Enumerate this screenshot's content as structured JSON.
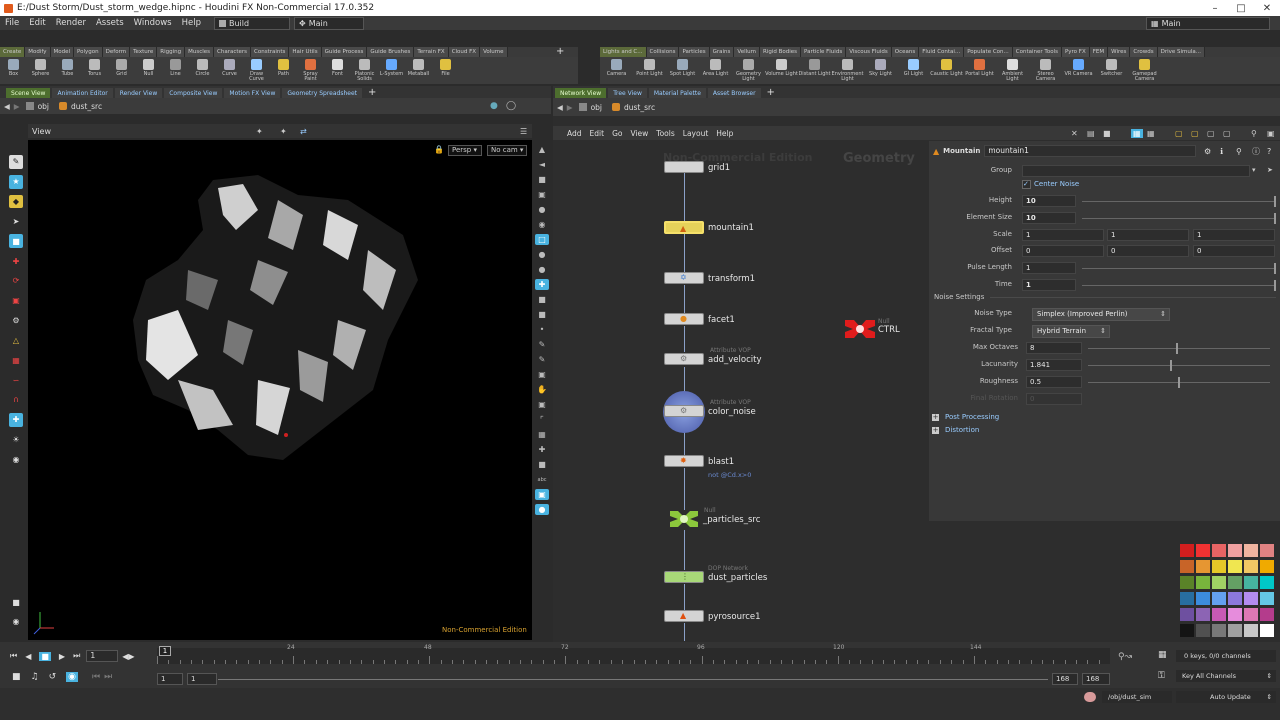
{
  "window": {
    "title": "E:/Dust Storm/Dust_storm_wedge.hipnc - Houdini FX Non-Commercial 17.0.352"
  },
  "menu": [
    "File",
    "Edit",
    "Render",
    "Assets",
    "Windows",
    "Help"
  ],
  "desktop": {
    "build": "Build",
    "main": "Main"
  },
  "shelf_left": {
    "tabs": [
      "Create",
      "Modify",
      "Model",
      "Polygon",
      "Deform",
      "Texture",
      "Rigging",
      "Muscles",
      "Characters",
      "Constraints",
      "Hair Utils",
      "Guide Process",
      "Guide Brushes",
      "Terrain FX",
      "Cloud FX",
      "Volume"
    ],
    "tools": [
      "Box",
      "Sphere",
      "Tube",
      "Torus",
      "Grid",
      "Null",
      "Line",
      "Circle",
      "Curve",
      "Draw Curve",
      "Path",
      "Spray Paint",
      "Font",
      "Platonic Solids",
      "L-System",
      "Metaball",
      "File"
    ]
  },
  "shelf_right": {
    "tabs": [
      "Lights and C...",
      "Collisions",
      "Particles",
      "Grains",
      "Vellum",
      "Rigid Bodies",
      "Particle Fluids",
      "Viscous Fluids",
      "Oceans",
      "Fluid Contai...",
      "Populate Con...",
      "Container Tools",
      "Pyro FX",
      "FEM",
      "Wires",
      "Crowds",
      "Drive Simula..."
    ],
    "tools": [
      "Camera",
      "Point Light",
      "Spot Light",
      "Area Light",
      "Geometry Light",
      "Volume Light",
      "Distant Light",
      "Environment Light",
      "Sky Light",
      "GI Light",
      "Caustic Light",
      "Portal Light",
      "Ambient Light",
      "Stereo Camera",
      "VR Camera",
      "Switcher",
      "Gamepad Camera"
    ]
  },
  "left_pane": {
    "tabs": [
      "Scene View",
      "Animation Editor",
      "Render View",
      "Composite View",
      "Motion FX View",
      "Geometry Spreadsheet"
    ],
    "path": [
      "obj",
      "dust_src"
    ],
    "view_label": "View",
    "persp": "Persp",
    "cam": "No cam",
    "watermark": "Non-Commercial Edition"
  },
  "right_pane": {
    "tabs": [
      "Network View",
      "Tree View",
      "Material Palette",
      "Asset Browser"
    ],
    "path": [
      "obj",
      "dust_src"
    ],
    "menu": [
      "Add",
      "Edit",
      "Go",
      "View",
      "Tools",
      "Layout",
      "Help"
    ],
    "nc_watermark": "Non-Commercial Edition",
    "context_label": "Geometry"
  },
  "nodes": [
    {
      "name": "grid1",
      "type": ""
    },
    {
      "name": "mountain1",
      "type": ""
    },
    {
      "name": "transform1",
      "type": ""
    },
    {
      "name": "facet1",
      "type": ""
    },
    {
      "name": "add_velocity",
      "type": "Attribute VOP"
    },
    {
      "name": "color_noise",
      "type": "Attribute VOP"
    },
    {
      "name": "blast1",
      "type": "",
      "comment": "not @Cd.x>0"
    },
    {
      "name": "_particles_src",
      "type": "Null"
    },
    {
      "name": "dust_particles",
      "type": "DOP Network"
    },
    {
      "name": "pyrosource1",
      "type": ""
    },
    {
      "name": "CTRL",
      "type": "Null"
    }
  ],
  "parms": {
    "node_type": "Mountain",
    "node_name": "mountain1",
    "group_label": "Group",
    "group_value": "",
    "center_noise": "Center Noise",
    "height": {
      "label": "Height",
      "value": "10"
    },
    "element_size": {
      "label": "Element Size",
      "value": "10"
    },
    "scale": {
      "label": "Scale",
      "values": [
        "1",
        "1",
        "1"
      ]
    },
    "offset": {
      "label": "Offset",
      "values": [
        "0",
        "0",
        "0"
      ]
    },
    "pulse_length": {
      "label": "Pulse Length",
      "value": "1"
    },
    "time": {
      "label": "Time",
      "value": "1"
    },
    "noise_settings": "Noise Settings",
    "noise_type": {
      "label": "Noise Type",
      "value": "Simplex (Improved Perlin)"
    },
    "fractal_type": {
      "label": "Fractal Type",
      "value": "Hybrid Terrain"
    },
    "max_octaves": {
      "label": "Max Octaves",
      "value": "8"
    },
    "lacunarity": {
      "label": "Lacunarity",
      "value": "1.841"
    },
    "roughness": {
      "label": "Roughness",
      "value": "0.5"
    },
    "final_rotation": {
      "label": "Final Rotation",
      "value": "0"
    },
    "post_processing": "Post Processing",
    "distortion": "Distortion"
  },
  "timeline": {
    "frame": "1",
    "frame_marker": "1",
    "ticks": [
      "24",
      "48",
      "72",
      "96",
      "120",
      "144"
    ],
    "range_start": "1",
    "range_start2": "1",
    "range_end": "168",
    "range_end2": "168",
    "keys": "0 keys, 0/0 channels",
    "key_all": "Key All Channels",
    "path": "/obj/dust_sim",
    "auto_update": "Auto Update"
  },
  "colors": {
    "accent": "#4d6e2e",
    "bg": "#2b2b2b",
    "node_selected": "#e6d25a",
    "ctrl_red": "#e01c1c",
    "null_green": "#8cc83c"
  },
  "palette": [
    "#d21e1e",
    "#f03232",
    "#e86464",
    "#f0a0a0",
    "#f0b4a0",
    "#e08282",
    "#c86428",
    "#e69632",
    "#e6c828",
    "#f0e650",
    "#f0c864",
    "#f0aa00",
    "#5a8228",
    "#78b43c",
    "#a0d264",
    "#64a064",
    "#46b4a0",
    "#00c8c8",
    "#286ea0",
    "#3c8cdc",
    "#64a0f0",
    "#8c78dc",
    "#b48cf0",
    "#64c8e6",
    "#6e50a0",
    "#8c64b4",
    "#c85ab4",
    "#e68cdc",
    "#dc78b4",
    "#b43c8c",
    "#141414",
    "#505050",
    "#787878",
    "#a0a0a0",
    "#c8c8c8",
    "#ffffff"
  ]
}
